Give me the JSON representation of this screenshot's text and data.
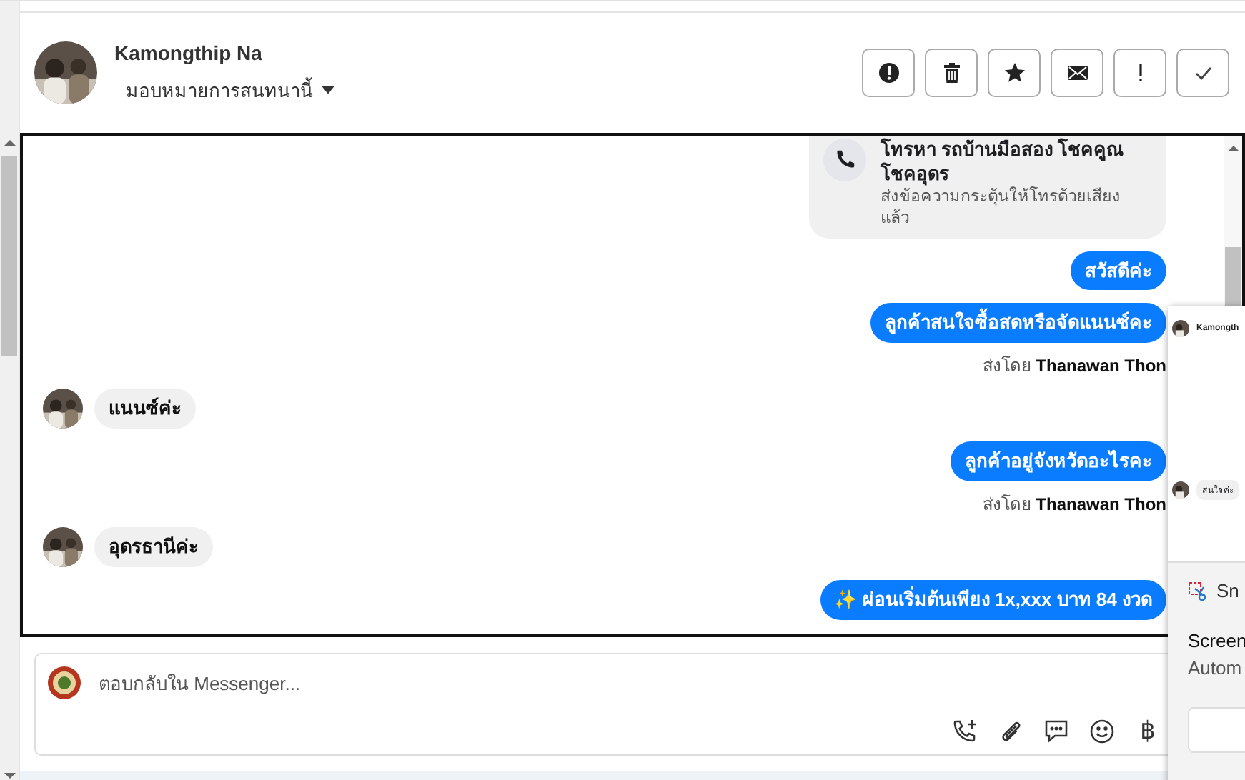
{
  "contact": {
    "name": "Kamongthip Na",
    "assign": "มอบหมายการสนทนานี้"
  },
  "actions": [
    {
      "kind": "alert"
    },
    {
      "kind": "trash"
    },
    {
      "kind": "star"
    },
    {
      "kind": "mail"
    },
    {
      "kind": "exclaim"
    },
    {
      "kind": "check"
    }
  ],
  "messages": [
    {
      "kind": "call",
      "title": "โทรหา รถบ้านมือสอง โชคคูณ โชคอุดร",
      "subtitle": "ส่งข้อความกระตุ้นให้โทรด้วยเสียงแล้ว"
    },
    {
      "kind": "out",
      "text": "สวัสดีค่ะ"
    },
    {
      "kind": "out",
      "text": "ลูกค้าสนใจซื้อสดหรือจัดแนนซ์คะ"
    },
    {
      "kind": "sender",
      "text": "ส่งโดย **Thanawan Thon**"
    },
    {
      "kind": "in",
      "text": "แนนซ์ค่ะ"
    },
    {
      "kind": "out",
      "text": "ลูกค้าอยู่จังหวัดอะไรคะ"
    },
    {
      "kind": "sender",
      "text": "ส่งโดย **Thanawan Thon**"
    },
    {
      "kind": "in",
      "text": "อุดรธานีค่ะ"
    },
    {
      "kind": "out",
      "text": "✨ ผ่อนเริ่มต้นเพียง 1x,xxx บาท 84 งวด"
    }
  ],
  "composer": {
    "placeholder": "ตอบกลับใน Messenger...",
    "tools": [
      {
        "kind": "call-add"
      },
      {
        "kind": "attach"
      },
      {
        "kind": "chat"
      },
      {
        "kind": "emoji"
      },
      {
        "kind": "text",
        "label": "฿"
      }
    ]
  },
  "notification": {
    "preview": {
      "name": "Kamongth",
      "bubble": "สนใจค่ะ"
    },
    "app": "Sn",
    "title": "Screen",
    "body": "Autom"
  }
}
